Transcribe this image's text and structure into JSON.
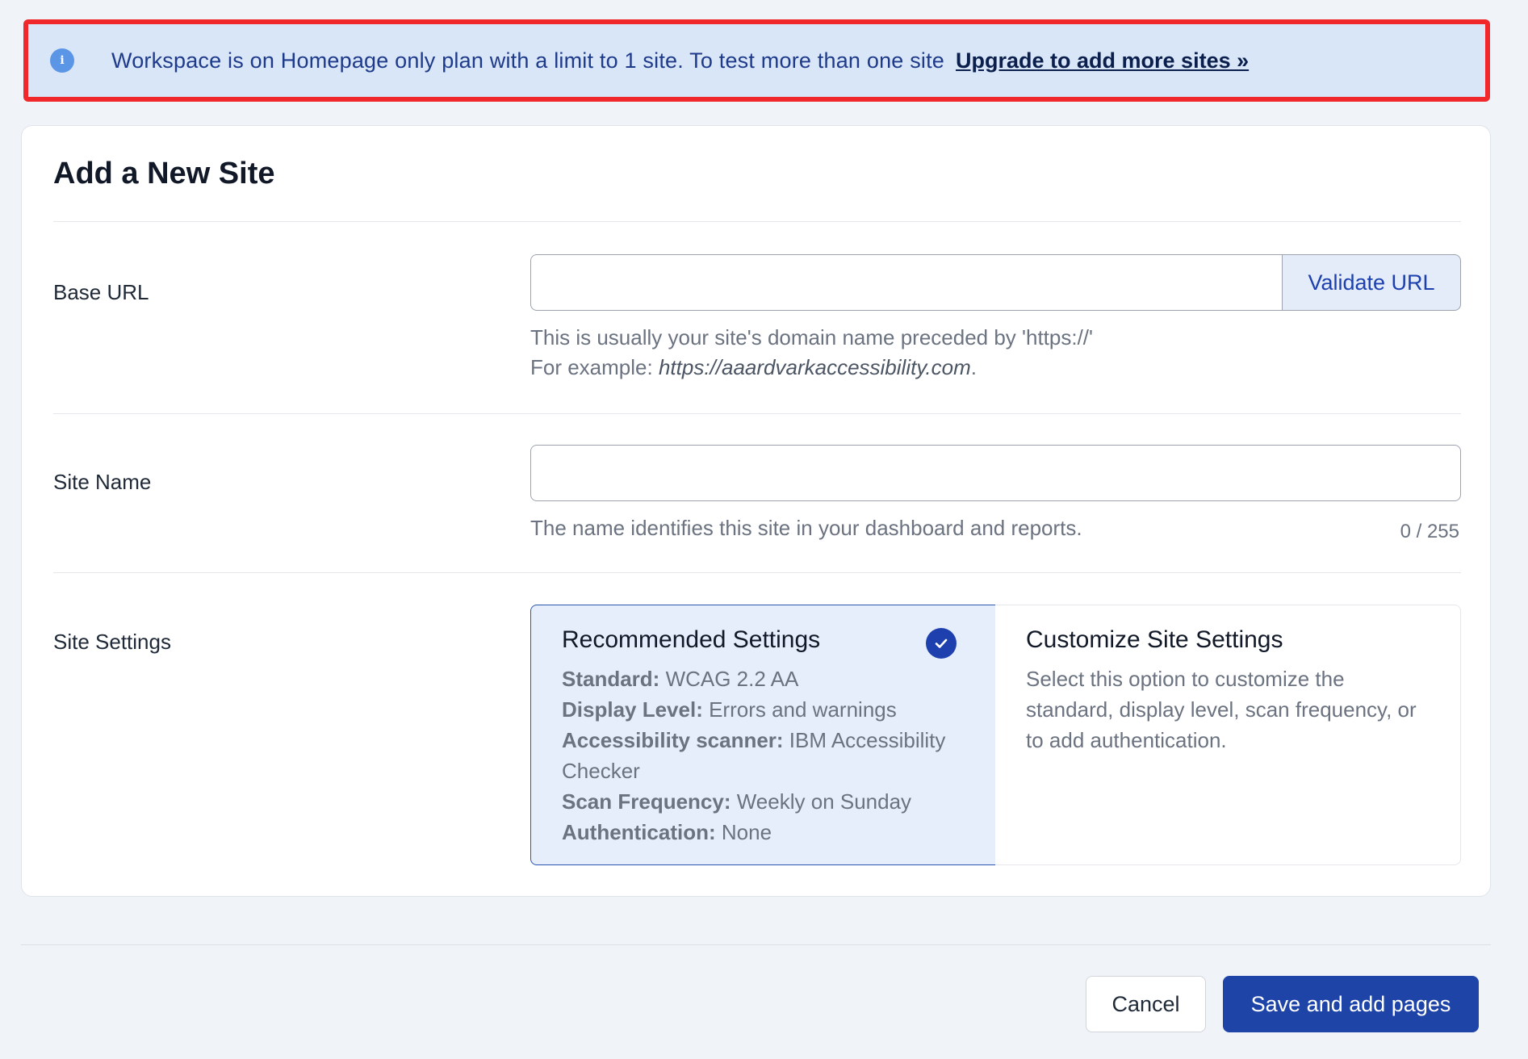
{
  "notice": {
    "icon": "info-icon",
    "icon_glyph": "i",
    "message": "Workspace is on Homepage only plan with a limit to 1 site. To test more than one site",
    "link_label": "Upgrade to add more sites »"
  },
  "form": {
    "title": "Add a New Site",
    "base_url": {
      "label": "Base URL",
      "value": "",
      "validate_label": "Validate URL",
      "help_line1": "This is usually your site's domain name preceded by 'https://'",
      "help_example_prefix": "For example: ",
      "help_example_url": "https://aaardvarkaccessibility.com",
      "help_example_suffix": "."
    },
    "site_name": {
      "label": "Site Name",
      "value": "",
      "help": "The name identifies this site in your dashboard and reports.",
      "counter": "0 / 255"
    },
    "site_settings": {
      "label": "Site Settings",
      "recommended": {
        "title": "Recommended Settings",
        "selected": true,
        "rows": [
          {
            "key": "Standard:",
            "value": " WCAG 2.2 AA"
          },
          {
            "key": "Display Level:",
            "value": " Errors and warnings"
          },
          {
            "key": "Accessibility scanner:",
            "value": " IBM Accessibility Checker"
          },
          {
            "key": "Scan Frequency:",
            "value": " Weekly on Sunday"
          },
          {
            "key": "Authentication:",
            "value": " None"
          }
        ]
      },
      "custom": {
        "title": "Customize Site Settings",
        "description": "Select this option to customize the standard, display level, scan frequency, or to add authentication."
      }
    }
  },
  "footer": {
    "cancel_label": "Cancel",
    "save_label": "Save and add pages"
  },
  "colors": {
    "accent": "#1e44a8",
    "notice_bg": "#d9e6f7",
    "notice_border": "#f0282c",
    "selected_bg": "#e6eefb"
  }
}
